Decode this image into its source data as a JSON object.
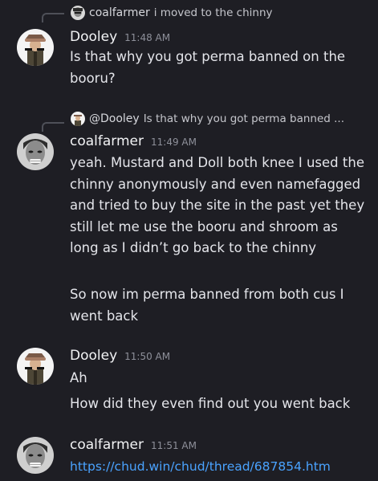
{
  "messages": [
    {
      "reply": {
        "author": "coalfarmer",
        "preview": "i moved to the chinny"
      },
      "author": "Dooley",
      "time": "11:48 AM",
      "lines": [
        "Is that why you got perma banned on the booru?"
      ]
    },
    {
      "reply": {
        "author": "@Dooley",
        "preview": "Is that why you got perma banned ..."
      },
      "author": "coalfarmer",
      "time": "11:49 AM",
      "lines": [
        "yeah. Mustard and Doll both knee I used the chinny anonymously and even namefagged and tried to buy the site in the past yet they still let me use the booru and shroom as long as I didn’t go back to the chinny",
        "So now im perma banned from both cus I went back"
      ]
    },
    {
      "author": "Dooley",
      "time": "11:50 AM",
      "lines": [
        "Ah",
        "How did they even find out you went back"
      ]
    },
    {
      "author": "coalfarmer",
      "time": "11:51 AM",
      "link": "https://chud.win/chud/thread/687854.htm"
    }
  ],
  "colors": {
    "background": "#1e1e24",
    "text": "#e4e5ea",
    "timestamp": "#8e909a",
    "link": "#4aa3ff"
  }
}
